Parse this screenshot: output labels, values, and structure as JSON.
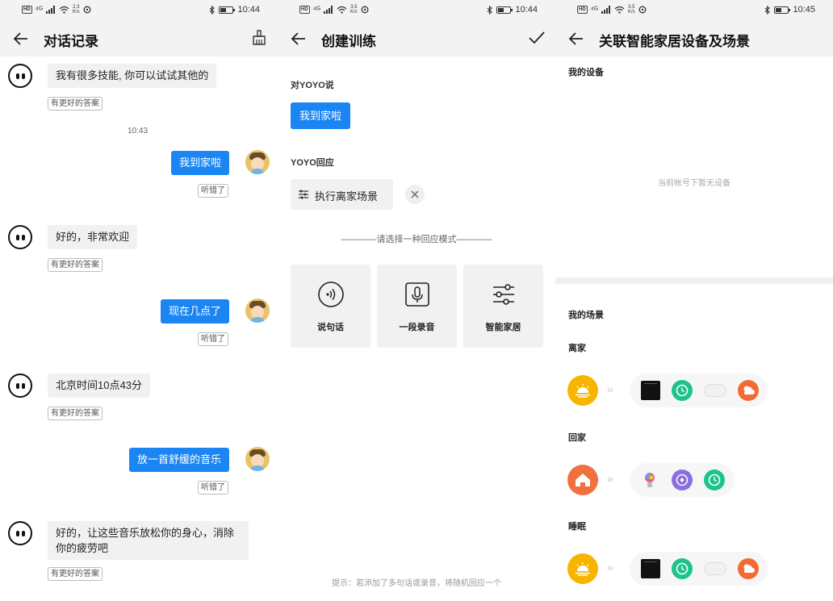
{
  "status_bars": [
    {
      "speed_top": "2.3",
      "speed_unit": "K/s",
      "time": "10:44"
    },
    {
      "speed_top": "3.5",
      "speed_unit": "K/s",
      "time": "10:44"
    },
    {
      "speed_top": "3.5",
      "speed_unit": "K/s",
      "time": "10:45"
    }
  ],
  "status_hd": "HD",
  "status_signal": "⁴ᴳ",
  "chat": {
    "title": "对话记录",
    "time_divider": "10:43",
    "bot_feedback": "有更好的答案",
    "user_feedback": "听错了",
    "messages": [
      {
        "from": "bot",
        "text": "我有很多技能, 你可以试试其他的"
      },
      {
        "from": "user",
        "text": "我到家啦"
      },
      {
        "from": "bot",
        "text": "好的，非常欢迎"
      },
      {
        "from": "user",
        "text": "现在几点了"
      },
      {
        "from": "bot",
        "text": "北京时间10点43分"
      },
      {
        "from": "user",
        "text": "放一首舒缓的音乐"
      },
      {
        "from": "bot",
        "text": "好的，让这些音乐放松你的身心，消除你的疲劳吧"
      }
    ]
  },
  "train": {
    "title": "创建训练",
    "say_label": "对YOYO说",
    "say_value": "我到家啦",
    "reply_label": "YOYO回应",
    "reply_value": "执行离家场景",
    "mode_hint": "————请选择一种回应模式————",
    "modes": [
      "说句话",
      "一段录音",
      "智能家居"
    ],
    "bottom_hint": "提示：若添加了多句话或录音，将随机回应一个"
  },
  "smart": {
    "title": "关联智能家居设备及场景",
    "devices_label": "我的设备",
    "devices_empty": "当前帐号下暂无设备",
    "scenes_label": "我的场景",
    "chevrons": "»",
    "scenes": [
      {
        "name": "离家",
        "icon": "sunrise-icon",
        "color": "#f7b500"
      },
      {
        "name": "回家",
        "icon": "home-icon",
        "color": "#f0703e"
      },
      {
        "name": "睡眠",
        "icon": "sunrise-icon",
        "color": "#f7b500"
      }
    ]
  },
  "colors": {
    "accent": "#1b86f3",
    "scene_yellow": "#f7b500",
    "scene_orange": "#f0703e",
    "device_green": "#1ec38a",
    "device_orange": "#f36a34",
    "device_purple": "#8a6fe0"
  }
}
